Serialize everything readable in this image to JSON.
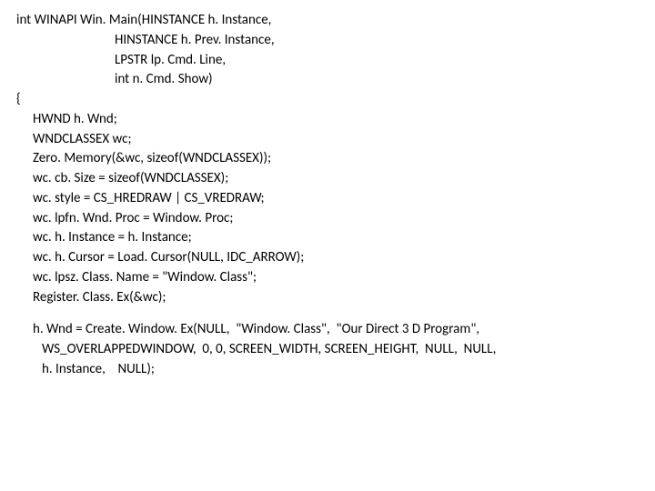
{
  "code": {
    "l01": "int WINAPI Win. Main(HINSTANCE h. Instance,",
    "l02": "HINSTANCE h. Prev. Instance,",
    "l03": "LPSTR lp. Cmd. Line,",
    "l04": "int n. Cmd. Show)",
    "l05": "{",
    "l06": "HWND h. Wnd;",
    "l07": "WNDCLASSEX wc;",
    "l08": "Zero. Memory(&wc, sizeof(WNDCLASSEX));",
    "l09": "wc. cb. Size = sizeof(WNDCLASSEX);",
    "l10": "wc. style = CS_HREDRAW | CS_VREDRAW;",
    "l11": "wc. lpfn. Wnd. Proc = Window. Proc;",
    "l12": "wc. h. Instance = h. Instance;",
    "l13": "wc. h. Cursor = Load. Cursor(NULL, IDC_ARROW);",
    "l14": "wc. lpsz. Class. Name = \"Window. Class\";",
    "l15": "Register. Class. Ex(&wc);",
    "l16": "h. Wnd = Create. Window. Ex(NULL,  \"Window. Class\",  \"Our Direct 3 D Program\",",
    "l17": "WS_OVERLAPPEDWINDOW,  0, 0, SCREEN_WIDTH, SCREEN_HEIGHT,  NULL,  NULL,",
    "l18": "h. Instance,    NULL);"
  }
}
